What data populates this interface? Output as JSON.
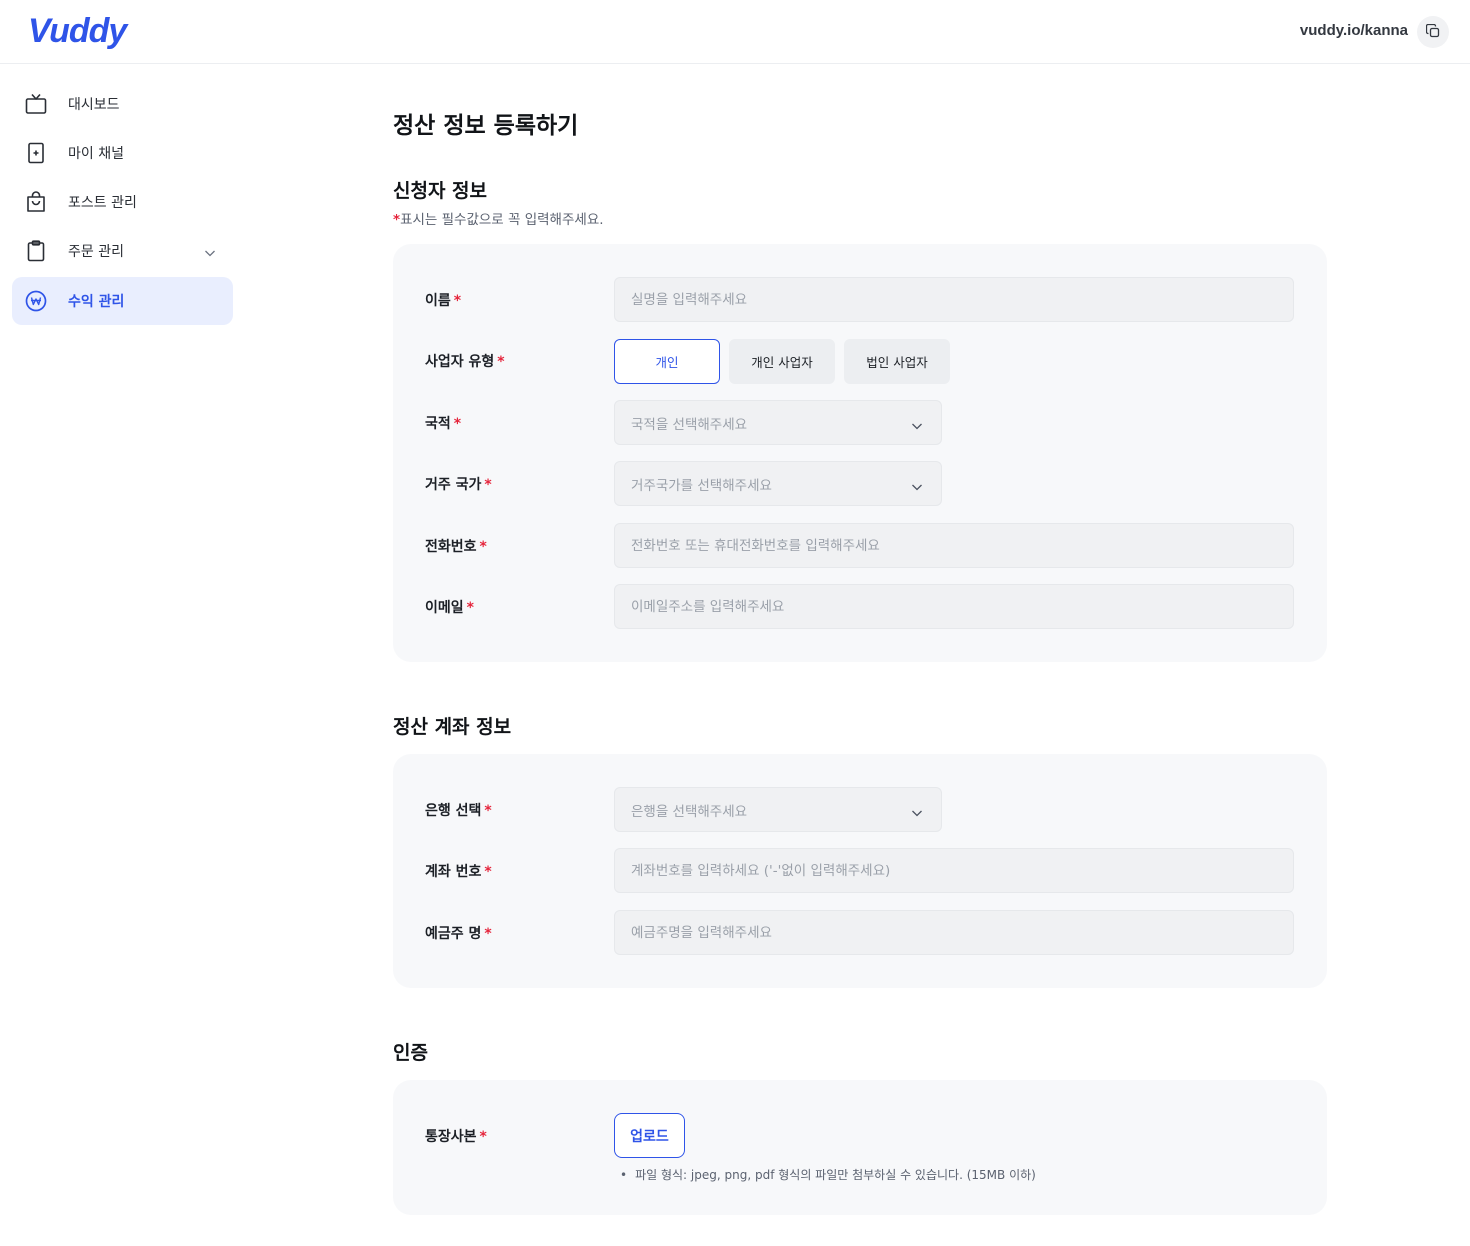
{
  "header": {
    "logo": "Vuddy",
    "profile_url": "vuddy.io/kanna",
    "copy_icon": "copy-icon"
  },
  "sidebar": {
    "items": [
      {
        "label": "대시보드",
        "icon": "tv-icon"
      },
      {
        "label": "마이 채널",
        "icon": "channel-card-icon"
      },
      {
        "label": "포스트 관리",
        "icon": "shopping-bag-icon"
      },
      {
        "label": "주문 관리",
        "icon": "clipboard-icon",
        "has_submenu": true
      },
      {
        "label": "수익 관리",
        "icon": "won-icon",
        "active": true
      }
    ]
  },
  "page": {
    "title": "정산 정보 등록하기"
  },
  "applicant": {
    "title": "신청자 정보",
    "required_star": "*",
    "required_note": "표시는 필수값으로 꼭 입력해주세요.",
    "name_label": "이름",
    "name_placeholder": "실명을 입력해주세요",
    "business_type_label": "사업자 유형",
    "business_types": [
      "개인",
      "개인 사업자",
      "법인 사업자"
    ],
    "business_type_selected": "개인",
    "nationality_label": "국적",
    "nationality_placeholder": "국적을 선택해주세요",
    "country_label": "거주 국가",
    "country_placeholder": "거주국가를 선택해주세요",
    "phone_label": "전화번호",
    "phone_placeholder": "전화번호 또는 휴대전화번호를 입력해주세요",
    "email_label": "이메일",
    "email_placeholder": "이메일주소를 입력해주세요"
  },
  "account": {
    "title": "정산 계좌 정보",
    "bank_label": "은행 선택",
    "bank_placeholder": "은행을 선택해주세요",
    "number_label": "계좌 번호",
    "number_placeholder": "계좌번호를 입력하세요 ('-'없이 입력해주세요)",
    "holder_label": "예금주 명",
    "holder_placeholder": "예금주명을 입력해주세요"
  },
  "verification": {
    "title": "인증",
    "bankbook_label": "통장사본",
    "upload_label": "업로드",
    "hint_bullet": "•",
    "hint": "파일 형식: jpeg, png, pdf 형식의 파일만 첨부하실 수 있습니다. (15MB 이하)"
  },
  "required_mark": "*",
  "colors": {
    "accent": "#2f54e8",
    "required": "#e5243b",
    "card_bg": "#f7f8fa",
    "active_nav_bg": "#e9eefe"
  }
}
